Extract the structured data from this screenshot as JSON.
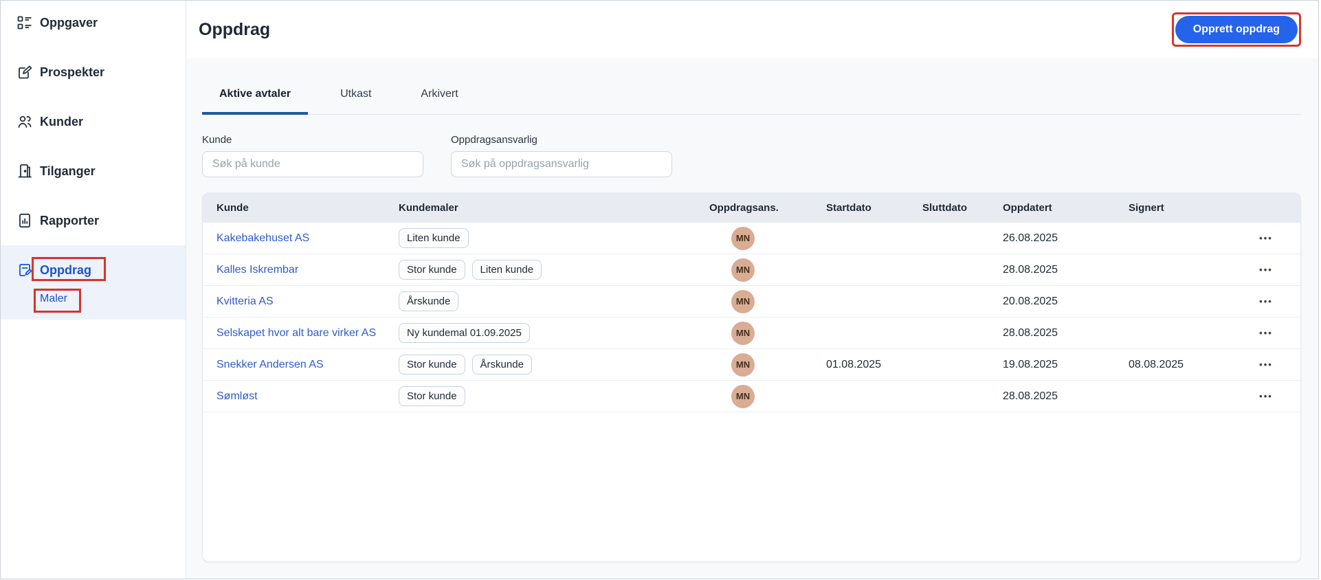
{
  "sidebar": {
    "items": [
      {
        "label": "Oppgaver"
      },
      {
        "label": "Prospekter"
      },
      {
        "label": "Kunder"
      },
      {
        "label": "Tilganger"
      },
      {
        "label": "Rapporter"
      },
      {
        "label": "Oppdrag",
        "active": true
      }
    ],
    "subitem": {
      "label": "Maler"
    }
  },
  "header": {
    "title": "Oppdrag",
    "create_button_label": "Opprett oppdrag"
  },
  "tabs": [
    {
      "label": "Aktive avtaler",
      "active": true
    },
    {
      "label": "Utkast",
      "active": false
    },
    {
      "label": "Arkivert",
      "active": false
    }
  ],
  "filters": {
    "kunde": {
      "label": "Kunde",
      "placeholder": "Søk på kunde",
      "value": ""
    },
    "ansvarlig": {
      "label": "Oppdragsansvarlig",
      "placeholder": "Søk på oppdragsansvarlig",
      "value": ""
    }
  },
  "table": {
    "columns": [
      "Kunde",
      "Kundemaler",
      "Oppdragsans.",
      "Startdato",
      "Sluttdato",
      "Oppdatert",
      "Signert"
    ],
    "rows": [
      {
        "kunde": "Kakebakehuset AS",
        "maler": [
          "Liten kunde"
        ],
        "ansvarlig_initials": "MN",
        "startdato": "",
        "sluttdato": "",
        "oppdatert": "26.08.2025",
        "signert": ""
      },
      {
        "kunde": "Kalles Iskrembar",
        "maler": [
          "Stor kunde",
          "Liten kunde"
        ],
        "ansvarlig_initials": "MN",
        "startdato": "",
        "sluttdato": "",
        "oppdatert": "28.08.2025",
        "signert": ""
      },
      {
        "kunde": "Kvitteria AS",
        "maler": [
          "Årskunde"
        ],
        "ansvarlig_initials": "MN",
        "startdato": "",
        "sluttdato": "",
        "oppdatert": "20.08.2025",
        "signert": ""
      },
      {
        "kunde": "Selskapet hvor alt bare virker AS",
        "maler": [
          "Ny kundemal 01.09.2025"
        ],
        "ansvarlig_initials": "MN",
        "startdato": "",
        "sluttdato": "",
        "oppdatert": "28.08.2025",
        "signert": ""
      },
      {
        "kunde": "Snekker Andersen AS",
        "maler": [
          "Stor kunde",
          "Årskunde"
        ],
        "ansvarlig_initials": "MN",
        "startdato": "01.08.2025",
        "sluttdato": "",
        "oppdatert": "19.08.2025",
        "signert": "08.08.2025"
      },
      {
        "kunde": "Sømløst",
        "maler": [
          "Stor kunde"
        ],
        "ansvarlig_initials": "MN",
        "startdato": "",
        "sluttdato": "",
        "oppdatert": "28.08.2025",
        "signert": ""
      }
    ]
  },
  "icons": {
    "row_menu_glyph": "•••"
  },
  "colors": {
    "primary_button": "#2563eb",
    "link_blue": "#2d5bd0",
    "active_nav_blue": "#1d54c9",
    "tab_underline": "#1f57a5",
    "annotation_red": "#d5352b",
    "avatar_bg": "#d9ac94",
    "table_header_bg": "#e8ecf2",
    "sidebar_active_bg": "#edf2fb",
    "content_bg": "#f8f9fa"
  }
}
